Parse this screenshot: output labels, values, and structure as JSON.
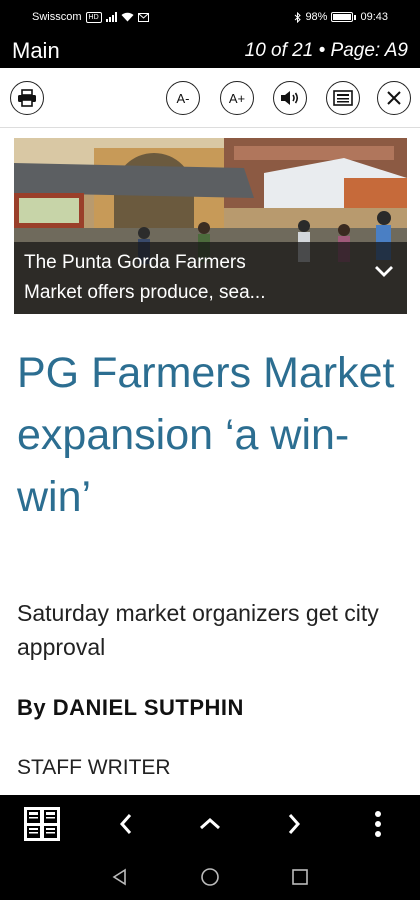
{
  "status_bar": {
    "carrier": "Swisscom",
    "network_badge": "HD",
    "battery_level": "98%",
    "time": "09:43",
    "icons": [
      "signal-icon",
      "wifi-icon",
      "message-icon",
      "bluetooth-icon",
      "battery-icon"
    ]
  },
  "title_bar": {
    "title": "Main",
    "page_info": "10 of 21 • Page: A9"
  },
  "toolbar": {
    "print_icon": "printer-icon",
    "font_decrease_label": "A-",
    "font_increase_label": "A+",
    "audio_icon": "speaker-icon",
    "article_view_icon": "article-view-icon",
    "close_icon": "close-icon"
  },
  "article": {
    "image_caption_line1": "The Punta Gorda Farmers",
    "image_caption_line2": "Market offers produce, sea...",
    "headline": "PG Farmers Market expansion ‘a win-win’",
    "subheadline": "Saturday market organizers get city approval",
    "byline": "By DANIEL SUTPHIN",
    "author_role": "STAFF WRITER"
  },
  "colors": {
    "headline": "#2c6e91",
    "bars": "#000000"
  },
  "bottom_bar": {
    "icons": [
      "page-grid-icon",
      "chevron-left-icon",
      "chevron-up-icon",
      "chevron-right-icon",
      "more-vertical-icon"
    ]
  },
  "system_nav": {
    "icons": [
      "back-icon",
      "home-icon",
      "recents-icon"
    ]
  }
}
